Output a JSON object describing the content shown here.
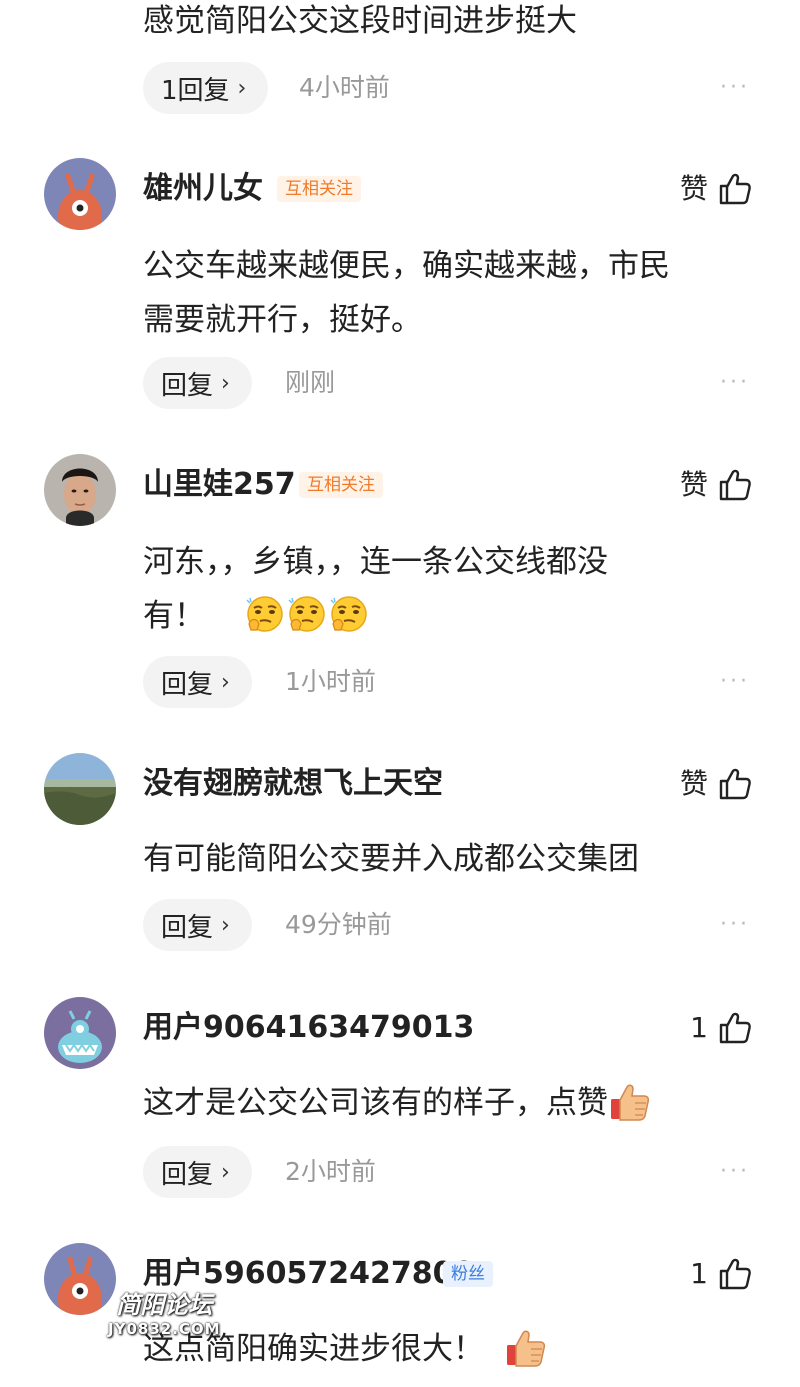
{
  "top_comment": {
    "content": "感觉简阳公交这段时间进步挺大",
    "reply_label": "1回复",
    "time": "4小时前"
  },
  "more_icon_glyph": "···",
  "reply_chevron_glyph": "›",
  "comments": [
    {
      "username": "雄州儿女",
      "tag": "互相关注",
      "like_label": "赞",
      "content_lines": [
        "公交车越来越便民，确实越来越，市民",
        "需要就开行，挺好。"
      ],
      "reply_label": "回复",
      "time": "刚刚"
    },
    {
      "username": "山里娃257",
      "tag": "互相关注",
      "like_label": "赞",
      "content_lines": [
        "河东，，乡镇，，连一条公交线都没",
        "有！"
      ],
      "reply_label": "回复",
      "time": "1小时前"
    },
    {
      "username": "没有翅膀就想飞上天空",
      "like_label": "赞",
      "content_lines": [
        "有可能简阳公交要并入成都公交集团"
      ],
      "reply_label": "回复",
      "time": "49分钟前"
    },
    {
      "username": "用户9064163479013",
      "like_label": "1",
      "content_lines": [
        "这才是公交公司该有的样子，点赞"
      ],
      "reply_label": "回复",
      "time": "2小时前"
    },
    {
      "username": "用户5960572427800",
      "tag": "粉丝",
      "like_label": "1",
      "content_lines": [
        "这点简阳确实进步很大！"
      ]
    }
  ],
  "watermark": {
    "line1": "简阳论坛",
    "line2": "JY0832.COM"
  },
  "icons": {
    "like": "thumbs-up-outline-icon",
    "more": "more-dots-icon",
    "emoji_thinking": "thinking-face-emoji",
    "emoji_thumbs_up": "thumbs-up-emoji"
  },
  "colors": {
    "mutual_tag_bg": "#fff3e8",
    "mutual_tag_text": "#f07a2a",
    "fan_tag_bg": "#e8f1fd",
    "fan_tag_text": "#3b7de0",
    "reply_button_bg": "#f3f3f3",
    "meta_text": "#999999"
  }
}
